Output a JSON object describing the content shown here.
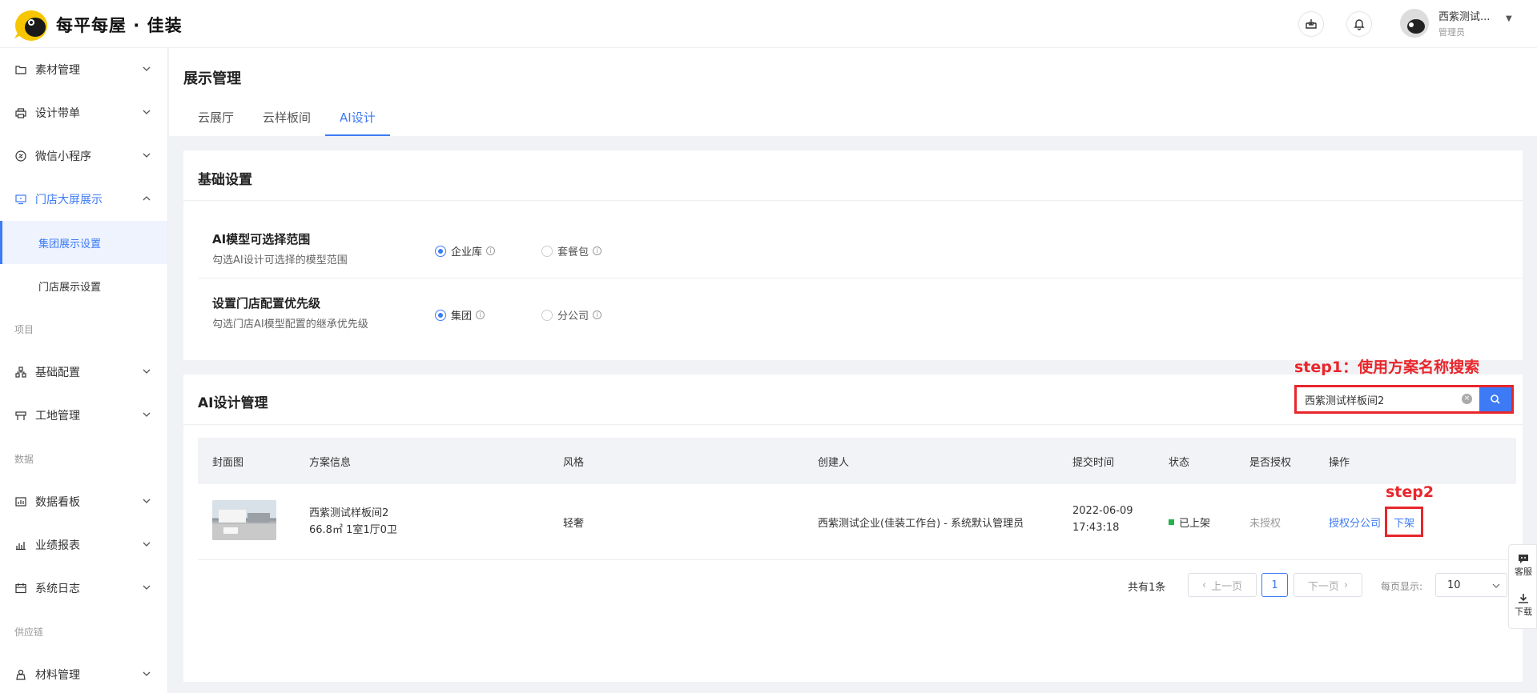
{
  "header": {
    "brand": "每平每屋 · 佳装",
    "user_name": "西紫测试...",
    "user_role": "管理员"
  },
  "sidebar": {
    "items": [
      {
        "label": "素材管理"
      },
      {
        "label": "设计带单"
      },
      {
        "label": "微信小程序"
      },
      {
        "label": "门店大屏展示"
      },
      {
        "label": "集团展示设置"
      },
      {
        "label": "门店展示设置"
      },
      {
        "label": "项目"
      },
      {
        "label": "基础配置"
      },
      {
        "label": "工地管理"
      },
      {
        "label": "数据"
      },
      {
        "label": "数据看板"
      },
      {
        "label": "业绩报表"
      },
      {
        "label": "系统日志"
      },
      {
        "label": "供应链"
      },
      {
        "label": "材料管理"
      }
    ]
  },
  "page": {
    "title": "展示管理",
    "tabs": [
      {
        "label": "云展厅"
      },
      {
        "label": "云样板间"
      },
      {
        "label": "AI设计"
      }
    ]
  },
  "basic_settings": {
    "title": "基础设置",
    "rows": [
      {
        "name": "AI模型可选择范围",
        "desc": "勾选AI设计可选择的模型范围",
        "options": [
          "企业库",
          "套餐包"
        ],
        "selected": "企业库"
      },
      {
        "name": "设置门店配置优先级",
        "desc": "勾选门店AI模型配置的继承优先级",
        "options": [
          "集团",
          "分公司"
        ],
        "selected": "集团"
      }
    ]
  },
  "ai_management": {
    "title": "AI设计管理",
    "search_value": "西紫测试样板间2",
    "annotation_step1": "step1：使用方案名称搜索",
    "annotation_step2": "step2",
    "columns": [
      "封面图",
      "方案信息",
      "风格",
      "创建人",
      "提交时间",
      "状态",
      "是否授权",
      "操作"
    ],
    "rows": [
      {
        "name": "西紫测试样板间2",
        "spec": "66.8㎡ 1室1厅0卫",
        "style": "轻奢",
        "creator": "西紫测试企业(佳装工作台) - 系统默认管理员",
        "date": "2022-06-09",
        "time": "17:43:18",
        "status": "已上架",
        "authorized": "未授权",
        "action_authorize": "授权分公司",
        "action_offshelf": "下架"
      }
    ],
    "pagination": {
      "total": "共有1条",
      "prev": "上一页",
      "current": "1",
      "next": "下一页",
      "per_page_label": "每页显示:",
      "per_page": "10"
    }
  },
  "side_tools": {
    "service": "客服",
    "download": "下载"
  },
  "colors": {
    "accent": "#3d7af5",
    "annotation": "#e8262b",
    "status_green": "#22b24c"
  }
}
